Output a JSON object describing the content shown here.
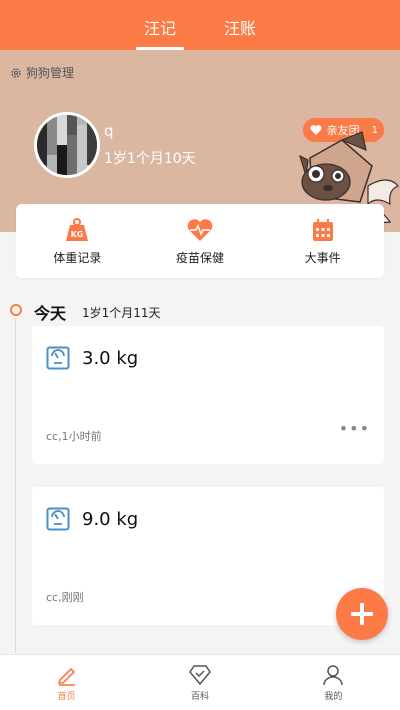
{
  "top_tabs": [
    {
      "label": "汪记",
      "active": true
    },
    {
      "label": "汪账",
      "active": false
    }
  ],
  "header": {
    "manage_label": "狗狗管理",
    "pet_name": "q",
    "pet_age": "1岁1个月10天",
    "friends_label": "亲友团",
    "friends_count": "1"
  },
  "actions": [
    {
      "label": "体重记录",
      "icon": "kg-weight-icon"
    },
    {
      "label": "疫苗保健",
      "icon": "heart-pulse-icon"
    },
    {
      "label": "大事件",
      "icon": "calendar-icon"
    }
  ],
  "timeline": {
    "day_label": "今天",
    "day_age": "1岁1个月11天",
    "records": [
      {
        "value": "3.0 kg",
        "meta": "cc,1小时前",
        "has_more": true
      },
      {
        "value": "9.0 kg",
        "meta": "cc,刚刚",
        "has_more": false
      }
    ]
  },
  "fab_icon": "plus-icon",
  "bottom_nav": [
    {
      "label": "首页",
      "icon": "pencil-icon",
      "active": true
    },
    {
      "label": "百科",
      "icon": "diamond-icon",
      "active": false
    },
    {
      "label": "我的",
      "icon": "person-icon",
      "active": false
    }
  ],
  "colors": {
    "accent": "#fb7a45",
    "header_bg": "#dbb6a1",
    "page_bg": "#f4f4f4"
  }
}
